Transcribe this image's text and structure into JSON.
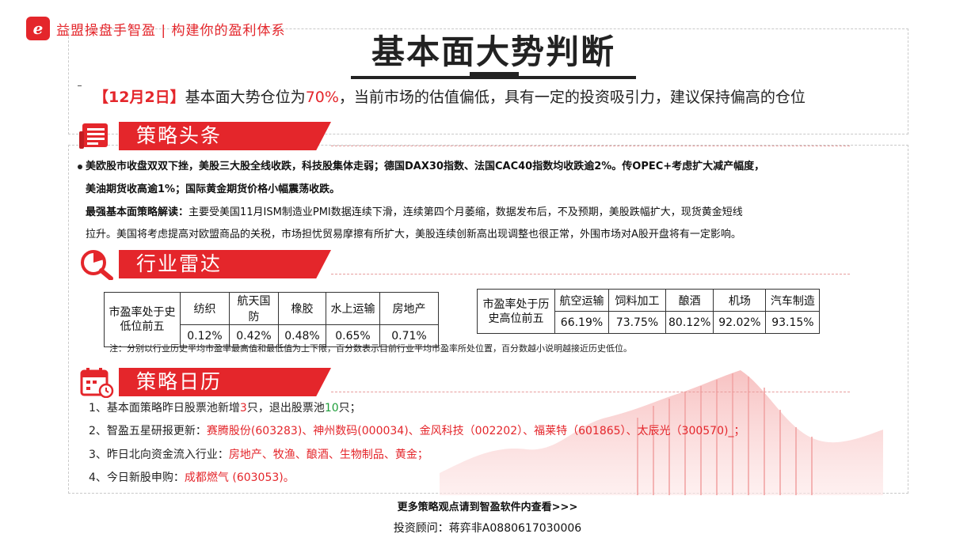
{
  "brand": {
    "text": "益盟操盘手智盈 | 构建你的盈利体系",
    "logo_glyph": "e",
    "color": "#e4262b"
  },
  "title": "基本面大势判断",
  "headline": {
    "date": "【12月2日】",
    "prefix": "基本面大势仓位为",
    "percent": "70%",
    "suffix": "，当前市场的估值偏低，具有一定的投资吸引力，建议保持偏高的仓位"
  },
  "sections": {
    "headlines": {
      "label": "策略头条",
      "icon": "news-icon"
    },
    "radar": {
      "label": "行业雷达",
      "icon": "radar-icon"
    },
    "calendar": {
      "label": "策略日历",
      "icon": "calendar-icon"
    }
  },
  "news": {
    "line1": "美欧股市收盘双双下挫，美股三大股全线收跌，科技股集体走弱；德国DAX30指数、法国CAC40指数均收跌逾2%。传OPEC+考虑扩大减产幅度，",
    "line2": "美油期货收高逾1%；国际黄金期货价格小幅震荡收跌。"
  },
  "analysis": {
    "lead": "最强基本面策略解读：",
    "line1": "主要受美国11月ISM制造业PMI数据连续下滑，连续第四个月萎缩，数据发布后，不及预期，美股跌幅扩大，现货黄金短线",
    "line2": "拉升。美国将考虑提高对欧盟商品的关税，市场担忧贸易摩擦有所扩大，美股连续创新高出现调整也很正常，外围市场对A股开盘将有一定影响。"
  },
  "pe_low": {
    "label_line1": "市盈率处于史",
    "label_line2": "低位前五",
    "industries": [
      "纺织",
      "航天国防",
      "橡胶",
      "水上运输",
      "房地产"
    ],
    "values": [
      "0.12%",
      "0.42%",
      "0.48%",
      "0.65%",
      "0.71%"
    ]
  },
  "pe_high": {
    "label_line1": "市盈率处于历",
    "label_line2": "史高位前五",
    "industries": [
      "航空运输",
      "饲料加工",
      "酿酒",
      "机场",
      "汽车制造"
    ],
    "values": [
      "66.19%",
      "73.75%",
      "80.12%",
      "92.02%",
      "93.15%"
    ]
  },
  "note": "注：分别以行业历史平均市盈率最高值和最低值为上下限，百分数表示目前行业平均市盈率所处位置，百分数越小说明越接近历史低位。",
  "calendar": {
    "item1": {
      "prefix": "1、基本面策略昨日股票池新增",
      "added": "3",
      "middle": "只，退出股票池",
      "removed": "10",
      "suffix": "只；"
    },
    "item2": {
      "prefix": "2、智盈五星研报更新：",
      "stocks": "赛腾股份(603283)、神州数码(000034)、金风科技（002202）、福莱特（601865）、太辰光（300570)_；"
    },
    "item3": {
      "prefix": "3、昨日北向资金流入行业：",
      "industries": "房地产、牧渔、酿酒、生物制品、黄金；"
    },
    "item4": {
      "prefix": "4、今日新股申购：",
      "ipo": "成都燃气  (603053)。"
    }
  },
  "footer": {
    "more": "更多策略观点请到智盈软件内查看>>>",
    "advisor": "投资顾问：蒋弈非A0880617030006"
  },
  "colors": {
    "accent": "#e4262b",
    "positive": "#1e9e3a"
  }
}
